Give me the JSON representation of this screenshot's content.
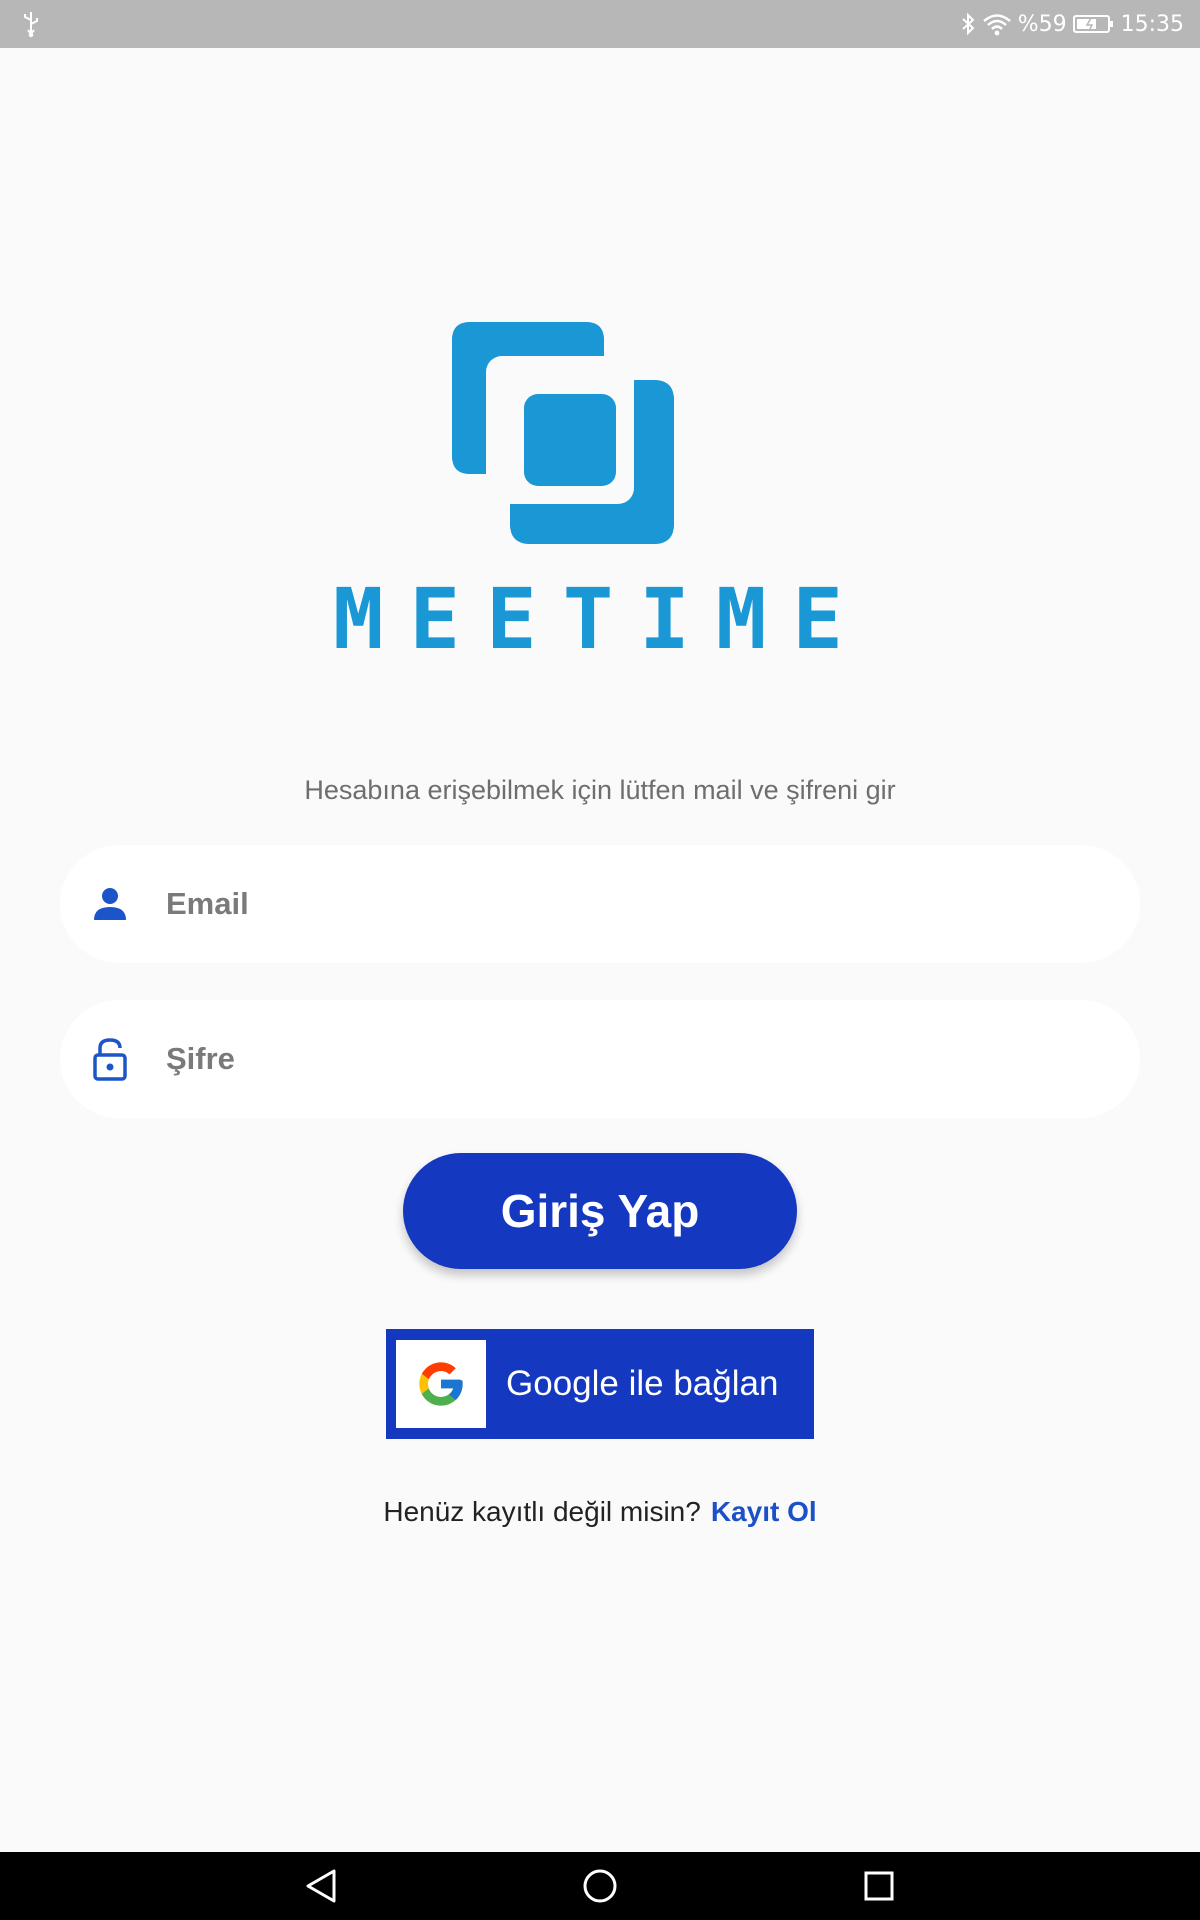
{
  "status_bar": {
    "battery_text": "%59",
    "time": "15:35"
  },
  "brand": {
    "name": "MEETIME",
    "color": "#1a97d5"
  },
  "login": {
    "subtitle": "Hesabına erişebilmek için lütfen mail ve şifreni gir",
    "email_placeholder": "Email",
    "password_placeholder": "Şifre",
    "login_button": "Giriş Yap",
    "google_button": "Google ile bağlan",
    "signup_prompt": "Henüz kayıtlı değil misin?",
    "signup_link": "Kayıt Ol"
  },
  "colors": {
    "primary": "#1438c0",
    "link": "#1c50c8",
    "icon": "#1b55c9",
    "background": "#fafafa"
  },
  "icons": {
    "email": "person-icon",
    "password": "lock-icon",
    "google": "google-logo-icon"
  }
}
